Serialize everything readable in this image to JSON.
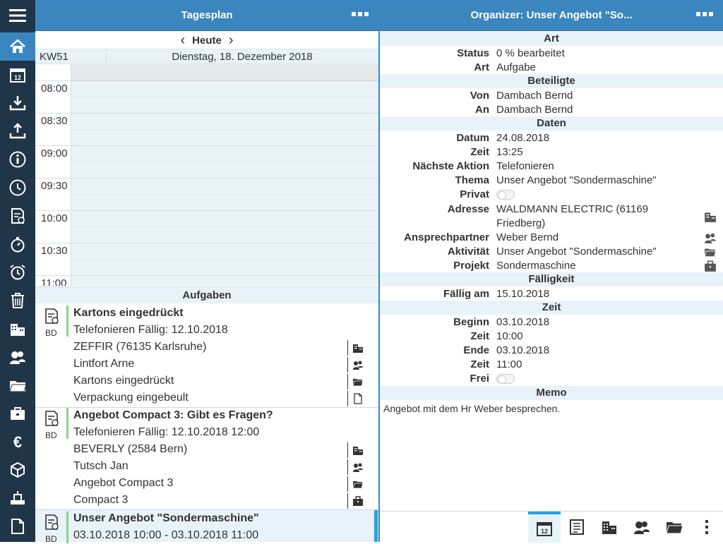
{
  "left_header": {
    "title": "Tagesplan"
  },
  "right_header": {
    "title": "Organizer: Unser Angebot \"So..."
  },
  "nav": {
    "prev": "‹",
    "today": "Heute",
    "next": "›"
  },
  "day": {
    "kw": "KW51",
    "date": "Dienstag, 18. Dezember 2018"
  },
  "times": [
    "08:00",
    "08:30",
    "09:00",
    "09:30",
    "10:00",
    "10:30",
    "11:00"
  ],
  "tasks_section": "Aufgaben",
  "tasks": [
    {
      "title": "Kartons eingedrückt",
      "sub": "Telefonieren Fällig: 12.10.2018",
      "initials": "BD",
      "lines": [
        {
          "text": "ZEFFIR (76135 Karlsruhe)",
          "icon": "building-icon"
        },
        {
          "text": "Lintfort Arne",
          "icon": "contacts-icon"
        },
        {
          "text": "Kartons eingedrückt",
          "icon": "folder-icon"
        },
        {
          "text": "Verpackung eingebeult",
          "icon": "document-icon"
        }
      ]
    },
    {
      "title": "Angebot Compact 3: Gibt es Fragen?",
      "sub": "Telefonieren Fällig: 12.10.2018 12:00",
      "initials": "BD",
      "lines": [
        {
          "text": "BEVERLY (2584 Bern)",
          "icon": "building-icon"
        },
        {
          "text": "Tutsch Jan",
          "icon": "contacts-icon"
        },
        {
          "text": "Angebot Compact 3",
          "icon": "folder-icon"
        },
        {
          "text": "Compact 3",
          "icon": "briefcase-icon"
        }
      ]
    },
    {
      "title": "Unser Angebot \"Sondermaschine\"",
      "sub": "03.10.2018 10:00 - 03.10.2018 11:00",
      "initials": "BD",
      "lines": []
    }
  ],
  "detail": {
    "sec_art": "Art",
    "status_label": "Status",
    "status_value": "0 % bearbeitet",
    "art_label": "Art",
    "art_value": "Aufgabe",
    "sec_beteiligte": "Beteiligte",
    "von_label": "Von",
    "von_value": "Dambach Bernd",
    "an_label": "An",
    "an_value": "Dambach Bernd",
    "sec_daten": "Daten",
    "datum_label": "Datum",
    "datum_value": "24.08.2018",
    "zeit_label": "Zeit",
    "zeit_value": "13:25",
    "naechste_label": "Nächste Aktion",
    "naechste_value": "Telefonieren",
    "thema_label": "Thema",
    "thema_value": "Unser Angebot \"Sondermaschine\"",
    "privat_label": "Privat",
    "adresse_label": "Adresse",
    "adresse_value1": "WALDMANN ELECTRIC (61169",
    "adresse_value2": "Friedberg)",
    "ansprech_label": "Ansprechpartner",
    "ansprech_value": "Weber Bernd",
    "aktivitaet_label": "Aktivität",
    "aktivitaet_value": "Unser Angebot \"Sondermaschine\"",
    "projekt_label": "Projekt",
    "projekt_value": "Sondermaschine",
    "sec_faelligkeit": "Fälligkeit",
    "faellig_label": "Fällig am",
    "faellig_value": "15.10.2018",
    "sec_zeit": "Zeit",
    "beginn_label": "Beginn",
    "beginn_value": "03.10.2018",
    "zeit2_label": "Zeit",
    "zeit2_value": "10:00",
    "ende_label": "Ende",
    "ende_value": "03.10.2018",
    "zeit3_label": "Zeit",
    "zeit3_value": "11:00",
    "frei_label": "Frei",
    "sec_memo": "Memo",
    "memo_value": "Angebot mit dem Hr Weber besprechen."
  },
  "colors": {
    "accent": "#3b86bf",
    "sidebar": "#213548",
    "light": "#e8f3f9",
    "select": "#27a3e0"
  }
}
